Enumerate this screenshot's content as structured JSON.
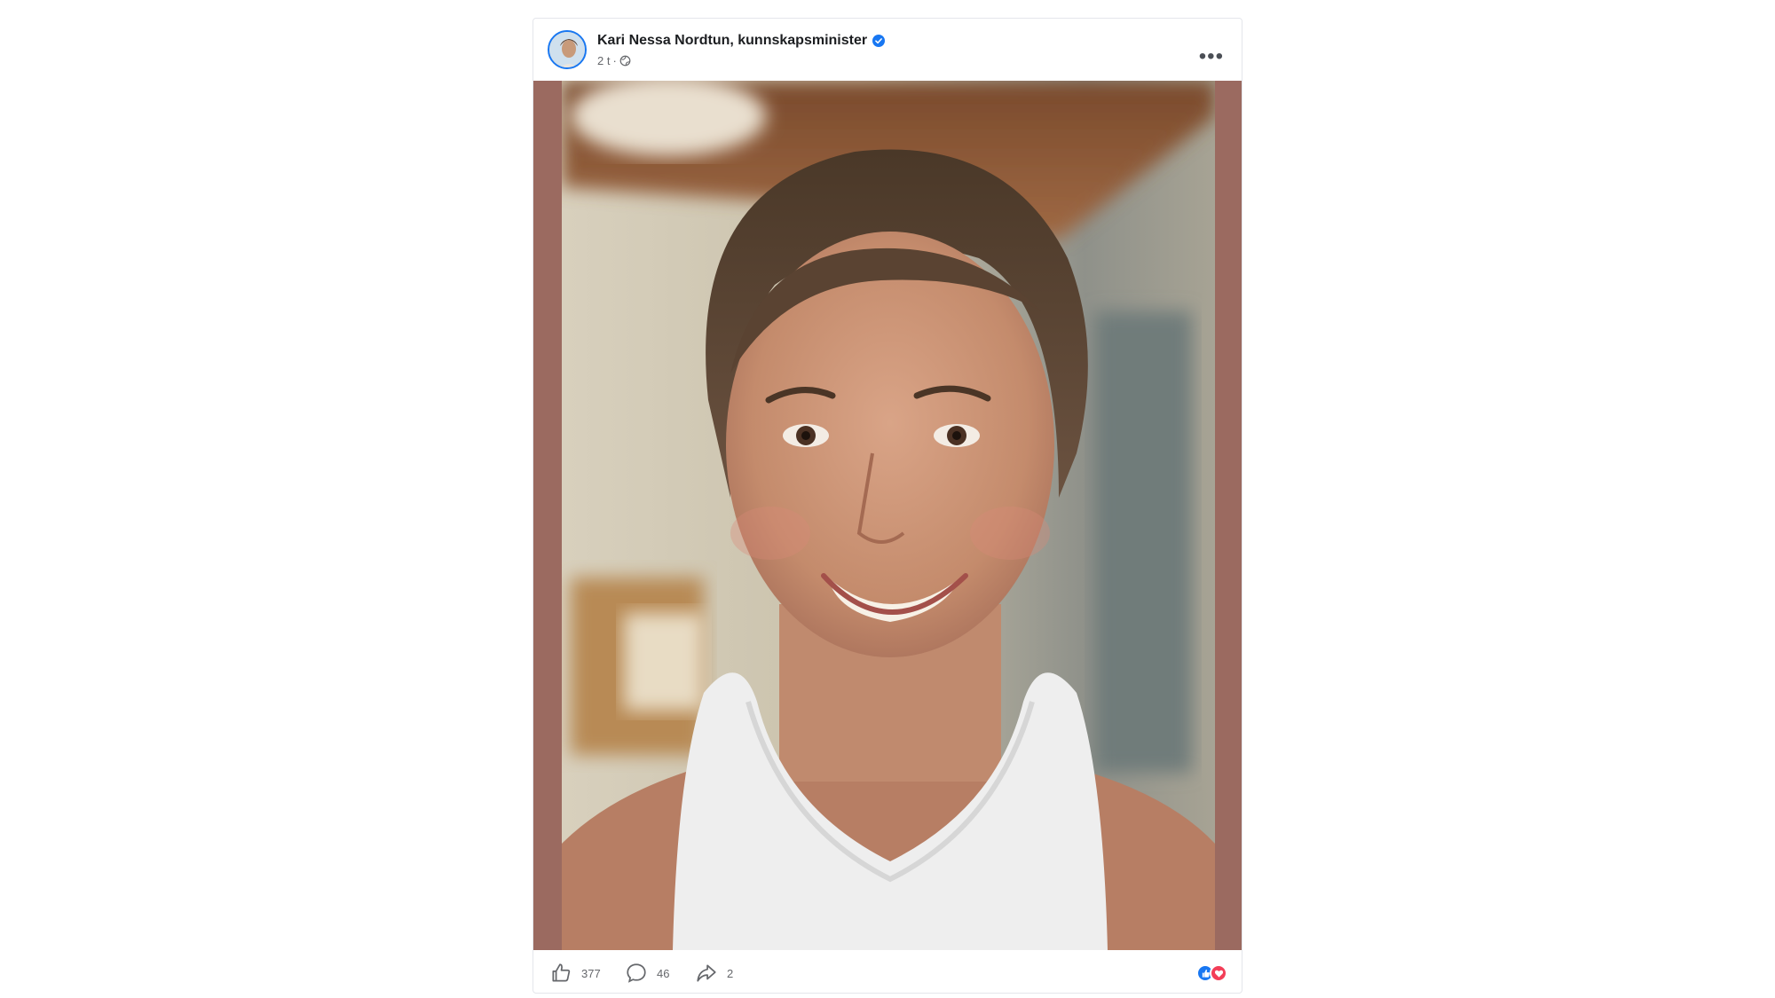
{
  "post": {
    "author": "Kari Nessa Nordtun, kunnskapsminister",
    "time": "2 t",
    "separator": "·",
    "more_label": "•••"
  },
  "stats": {
    "likes": "377",
    "comments": "46",
    "shares": "2"
  },
  "icons": {
    "verified": "verified-badge-icon",
    "audience": "globe-icon",
    "like": "thumbs-up-icon",
    "comment": "comment-bubble-icon",
    "share": "share-arrow-icon",
    "reaction_like": "like-reaction-icon",
    "reaction_love": "love-reaction-icon"
  },
  "colors": {
    "photo_border": "#9b6a60",
    "brand_blue": "#1877f2",
    "love_red": "#f33e58"
  }
}
